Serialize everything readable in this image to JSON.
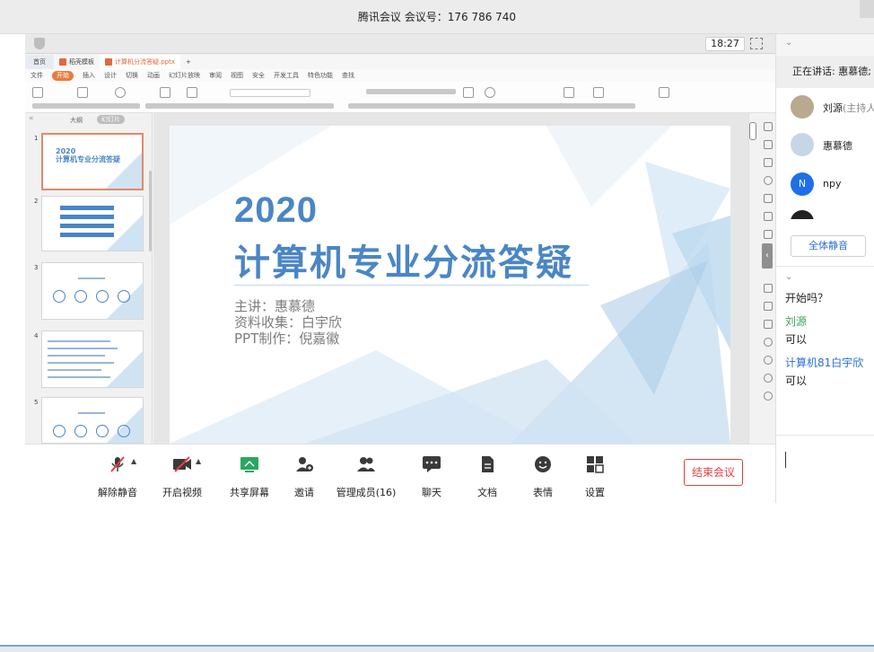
{
  "window": {
    "title": "腾讯会议 会议号：176 786 740"
  },
  "share": {
    "clock": "18:27"
  },
  "wps": {
    "home_tab": "首页",
    "tabs": [
      "稻壳模板",
      "计算机分流答疑.pptx"
    ],
    "menu": [
      "文件",
      "开始",
      "插入",
      "设计",
      "切换",
      "动画",
      "幻灯片放映",
      "审阅",
      "视图",
      "安全",
      "开发工具",
      "特色功能",
      "查找"
    ],
    "active_menu": "开始"
  },
  "thumbs": {
    "outline_label": "大纲",
    "slides_label": "幻灯片",
    "numbers": [
      "1",
      "2",
      "3",
      "4",
      "5"
    ],
    "slide1_title_line1": "2020",
    "slide1_title_line2": "计算机专业分流答疑"
  },
  "slide": {
    "year": "2020",
    "title": "计算机专业分流答疑",
    "presenter": "主讲：惠慕德",
    "material": "资料收集：白宇欣",
    "ppt": "PPT制作：倪嘉徽"
  },
  "toolbar": {
    "unmute": "解除静音",
    "video": "开启视频",
    "share": "共享屏幕",
    "invite": "邀请",
    "members": "管理成员(16)",
    "chat": "聊天",
    "docs": "文档",
    "emoji": "表情",
    "settings": "设置",
    "end": "结束会议"
  },
  "panel": {
    "speaking": "正在讲话: 惠慕德;",
    "participants": [
      {
        "name": "刘源",
        "role": "(主持人"
      },
      {
        "name": "惠慕德"
      },
      {
        "name": "npy",
        "initial": "N"
      }
    ],
    "mute_all": "全体静音"
  },
  "chat": {
    "messages": [
      {
        "text": "开始吗？"
      },
      {
        "sender": "刘源",
        "text": "可以"
      },
      {
        "sender": "计算机81白宇欣",
        "text": "可以"
      }
    ]
  },
  "colors": {
    "accent_blue": "#4a86c5",
    "end_red": "#e24040",
    "wps_orange": "#e2683c"
  }
}
